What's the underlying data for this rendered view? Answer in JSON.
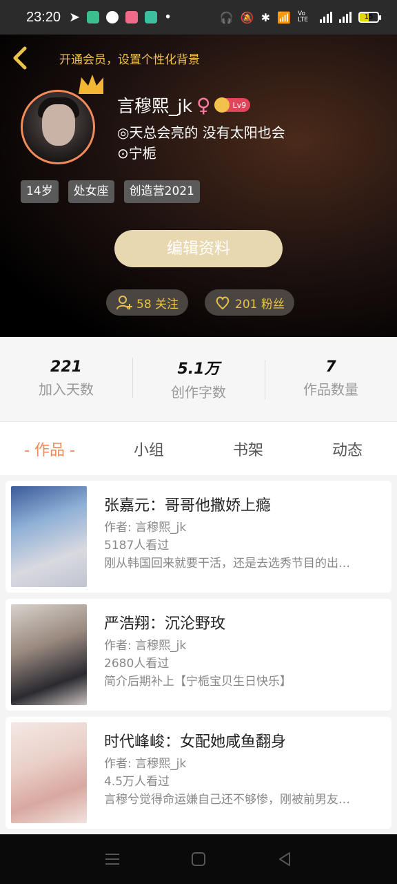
{
  "status_bar": {
    "time": "23:20",
    "battery": "15",
    "network": "Vo LTE"
  },
  "header": {
    "vip_banner": "开通会员，设置个性化背景"
  },
  "profile": {
    "username": "言穆熙_jk",
    "gender_symbol": "♀",
    "level": "Lv9",
    "bio": "◎天总会亮的 没有太阳也会",
    "location": "⊙宁栀",
    "tags": [
      "14岁",
      "处女座",
      "创造营2021"
    ],
    "edit_button": "编辑资料",
    "following": "58 关注",
    "followers": "201 粉丝"
  },
  "stats": [
    {
      "value": "221",
      "label": "加入天数"
    },
    {
      "value": "5.1万",
      "label": "创作字数"
    },
    {
      "value": "7",
      "label": "作品数量"
    }
  ],
  "tabs": [
    "- 作品 -",
    "小组",
    "书架",
    "动态"
  ],
  "works": [
    {
      "title": "张嘉元：哥哥他撒娇上瘾",
      "author": "作者: 言穆熙_jk",
      "views": "5187人看过",
      "desc": "刚从韩国回来就要干活，还是去选秀节目的出…"
    },
    {
      "title": "严浩翔：沉沦野玫",
      "author": "作者: 言穆熙_jk",
      "views": "2680人看过",
      "desc": "简介后期补上【宁栀宝贝生日快乐】"
    },
    {
      "title": "时代峰峻：女配她咸鱼翻身",
      "author": "作者: 言穆熙_jk",
      "views": "4.5万人看过",
      "desc": "言穆兮觉得命运嫌自己还不够惨，刚被前男友…"
    }
  ],
  "colors": {
    "accent": "#f08a55",
    "gold": "#e9c24b",
    "edit_button_bg": "#e8d8b0"
  }
}
